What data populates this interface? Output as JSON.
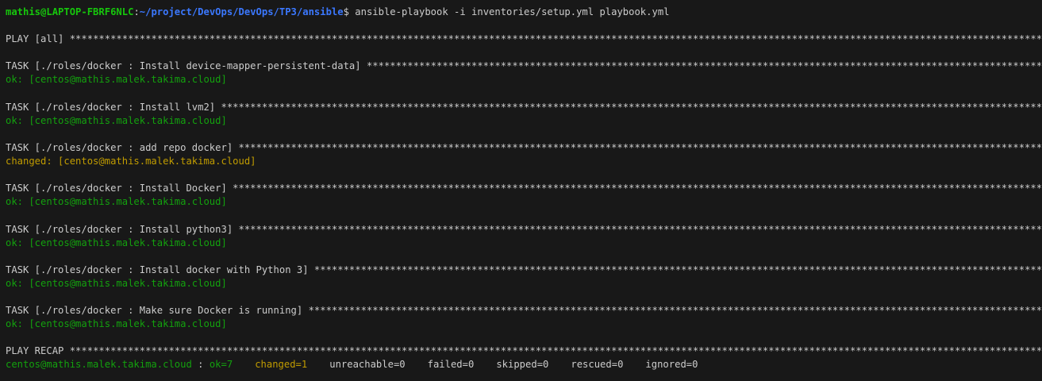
{
  "prompt": {
    "user_host": "mathis@LAPTOP-FBRF6NLC",
    "colon": ":",
    "path": "~/project/DevOps/DevOps/TP3/ansible",
    "dollar": "$",
    "command": " ansible-playbook -i inventories/setup.yml playbook.yml"
  },
  "play": {
    "header": "PLAY [all] ",
    "stars": "**************************************************************************************************************************************************************************************"
  },
  "tasks": [
    {
      "header": "TASK [./roles/docker : Install device-mapper-persistent-data] ",
      "stars": "***********************************************************************************************************************************",
      "status": "ok: [centos@mathis.malek.takima.cloud]",
      "status_type": "ok"
    },
    {
      "header": "TASK [./roles/docker : Install lvm2] ",
      "stars": "*********************************************************************************************************************************************************************",
      "status": "ok: [centos@mathis.malek.takima.cloud]",
      "status_type": "ok"
    },
    {
      "header": "TASK [./roles/docker : add repo docker] ",
      "stars": "*******************************************************************************************************************************************************************",
      "status": "changed: [centos@mathis.malek.takima.cloud]",
      "status_type": "changed"
    },
    {
      "header": "TASK [./roles/docker : Install Docker] ",
      "stars": "*******************************************************************************************************************************************************************",
      "status": "ok: [centos@mathis.malek.takima.cloud]",
      "status_type": "ok"
    },
    {
      "header": "TASK [./roles/docker : Install python3] ",
      "stars": "******************************************************************************************************************************************************************",
      "status": "ok: [centos@mathis.malek.takima.cloud]",
      "status_type": "ok"
    },
    {
      "header": "TASK [./roles/docker : Install docker with Python 3] ",
      "stars": "*********************************************************************************************************************************************************",
      "status": "ok: [centos@mathis.malek.takima.cloud]",
      "status_type": "ok"
    },
    {
      "header": "TASK [./roles/docker : Make sure Docker is running] ",
      "stars": "**********************************************************************************************************************************************************",
      "status": "ok: [centos@mathis.malek.takima.cloud]",
      "status_type": "ok"
    }
  ],
  "recap": {
    "header": "PLAY RECAP ",
    "stars": "**************************************************************************************************************************************************************************************",
    "host": "centos@mathis.malek.takima.cloud",
    "sep": " : ",
    "ok": "ok=7",
    "changed": "changed=1",
    "unreachable": "unreachable=0",
    "failed": "failed=0",
    "skipped": "skipped=0",
    "rescued": "rescued=0",
    "ignored": "ignored=0"
  },
  "colors": {
    "background": "#181818",
    "text": "#cccccc",
    "ok": "#13a10e",
    "changed": "#c19c00",
    "prompt_user": "#16c60c",
    "prompt_path": "#3b78ff"
  }
}
